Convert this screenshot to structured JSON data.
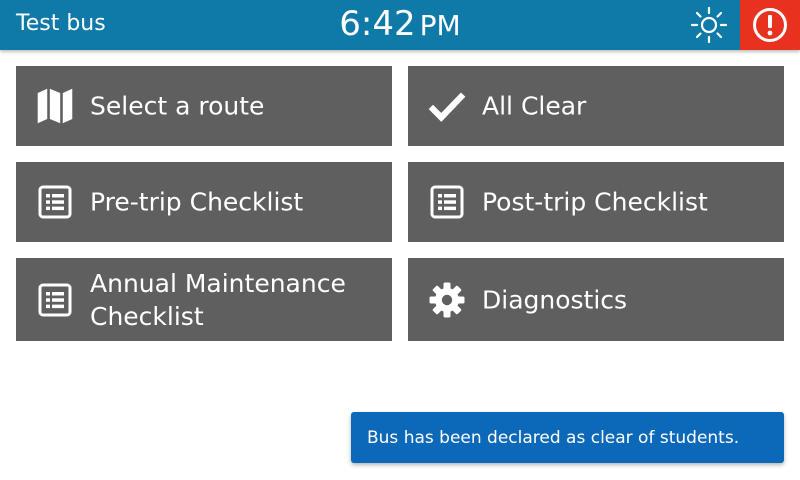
{
  "header": {
    "bus_name": "Test bus",
    "time": "6:42",
    "ampm": "PM",
    "brightness_icon": "sun-icon",
    "alert_icon": "exclamation-circle-icon",
    "bar_color": "#0f7aa8",
    "alert_color": "#e8321f"
  },
  "menu": {
    "tile_color": "#5f5f5f",
    "items": [
      {
        "label": "Select a route",
        "icon": "map-icon"
      },
      {
        "label": "All Clear",
        "icon": "checkmark-icon"
      },
      {
        "label": "Pre-trip Checklist",
        "icon": "checklist-icon"
      },
      {
        "label": "Post-trip Checklist",
        "icon": "checklist-icon"
      },
      {
        "label": "Annual Maintenance Checklist",
        "icon": "checklist-icon"
      },
      {
        "label": "Diagnostics",
        "icon": "gear-icon"
      }
    ]
  },
  "toast": {
    "message": "Bus has been declared as clear of students.",
    "color": "#0c68b8"
  }
}
